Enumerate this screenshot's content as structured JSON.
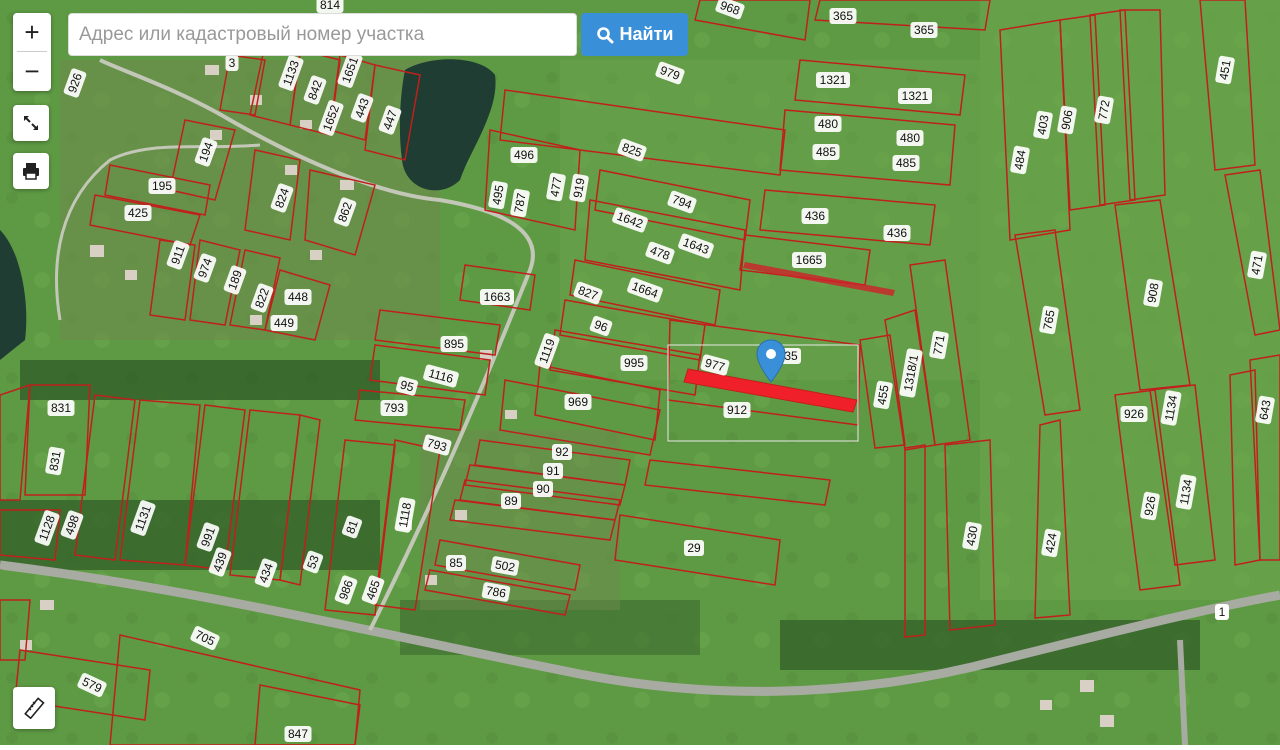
{
  "search": {
    "placeholder": "Адрес или кадастровый номер участка",
    "button_label": "Найти",
    "button_icon": "search-icon"
  },
  "controls": {
    "zoom_in_label": "+",
    "zoom_out_label": "−",
    "fullscreen_icon": "fullscreen-icon",
    "print_icon": "print-icon",
    "ruler_icon": "ruler-icon"
  },
  "colors": {
    "parcel_border": "#c0201c",
    "highlight_parcel": "#f0202a",
    "marker": "#3a8fd9",
    "button": "#3a8fd9"
  },
  "map": {
    "marker_icon": "location-pin-icon",
    "highlighted_parcel": "912",
    "road_label": "1",
    "parcel_labels": [
      "814",
      "968",
      "365",
      "365",
      "926",
      "3",
      "1133",
      "1651",
      "842",
      "1652",
      "443",
      "447",
      "979",
      "1321",
      "1321",
      "451",
      "403",
      "906",
      "772",
      "480",
      "480",
      "485",
      "485",
      "194",
      "195",
      "425",
      "824",
      "862",
      "496",
      "825",
      "794",
      "495",
      "787",
      "477",
      "919",
      "1642",
      "478",
      "1643",
      "436",
      "436",
      "484",
      "911",
      "974",
      "189",
      "822",
      "448",
      "449",
      "1663",
      "827",
      "1664",
      "1665",
      "471",
      "765",
      "908",
      "895",
      "96",
      "995",
      "977",
      "35",
      "1116",
      "95",
      "1119",
      "793",
      "969",
      "912",
      "1318/1",
      "771",
      "455",
      "831",
      "831",
      "926",
      "1134",
      "643",
      "793",
      "92",
      "91",
      "90",
      "89",
      "1128",
      "498",
      "1131",
      "991",
      "439",
      "434",
      "53",
      "81",
      "1118",
      "29",
      "926",
      "1134",
      "430",
      "424",
      "85",
      "502",
      "786",
      "986",
      "465",
      "705",
      "579",
      "847"
    ]
  }
}
